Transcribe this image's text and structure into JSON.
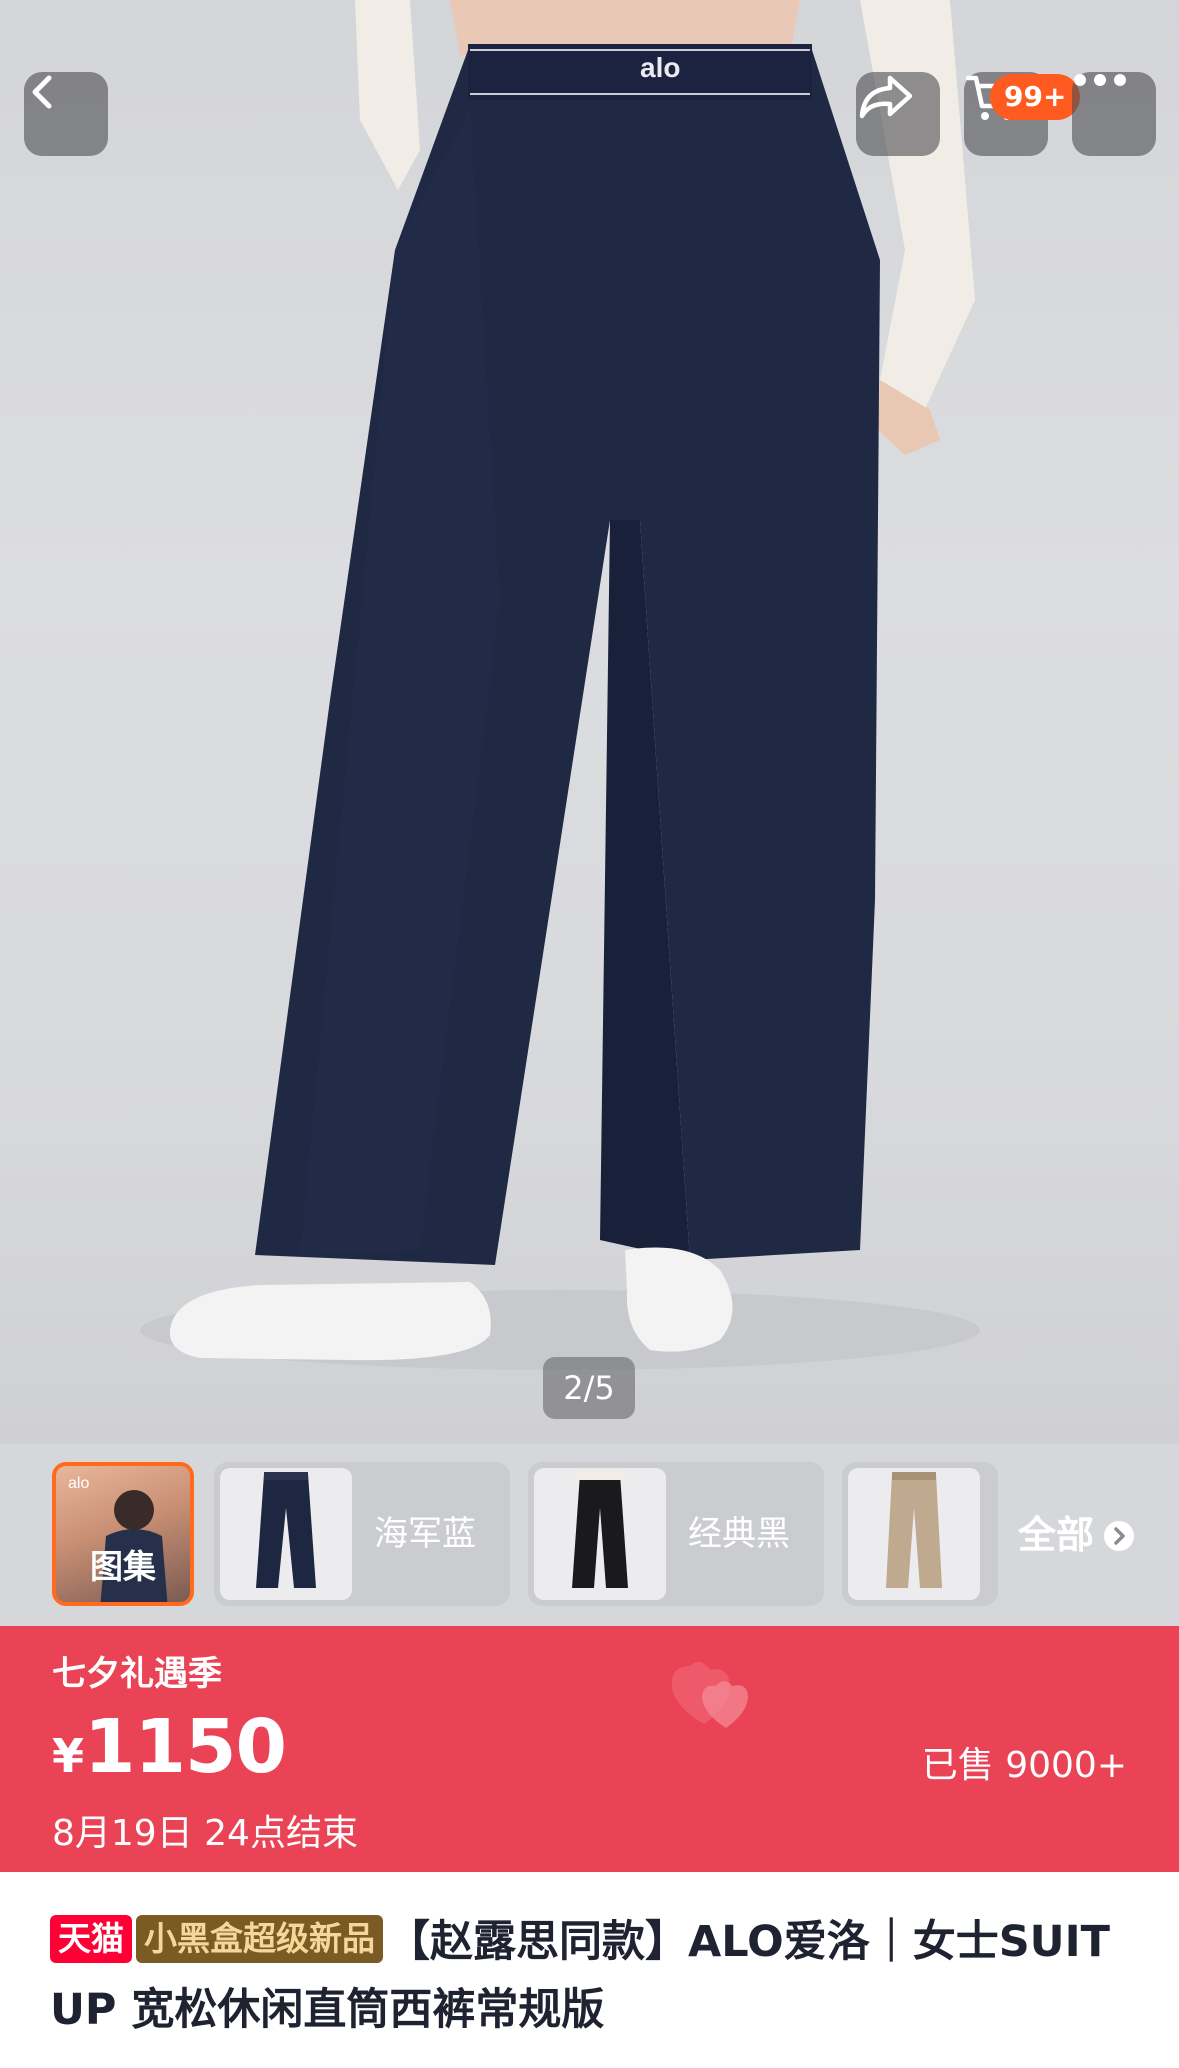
{
  "nav": {
    "cart_badge": "99+"
  },
  "hero": {
    "brand_logo": "alo",
    "image_counter": "2/5"
  },
  "variants": {
    "gallery_label": "图集",
    "items": [
      {
        "label": "海军蓝",
        "color": "#1e2742"
      },
      {
        "label": "经典黑",
        "color": "#1a1a1c"
      },
      {
        "label": "",
        "color": "#bfa98f"
      }
    ],
    "all_label": "全部"
  },
  "price_banner": {
    "promo_title": "七夕礼遇季",
    "currency": "¥",
    "price": "1150",
    "deadline": "8月19日 24点结束",
    "sold": "已售 9000+",
    "background_color": "#ea4356"
  },
  "title": {
    "tag_tmall": "天猫",
    "tag_new": "小黑盒超级新品",
    "text": "【赵露思同款】ALO爱洛｜女士SUIT UP 宽松休闲直筒西裤常规版"
  },
  "icons": [
    "back-arrow-icon",
    "share-icon",
    "cart-icon",
    "more-icon",
    "chevron-right-icon",
    "heart-icon"
  ]
}
